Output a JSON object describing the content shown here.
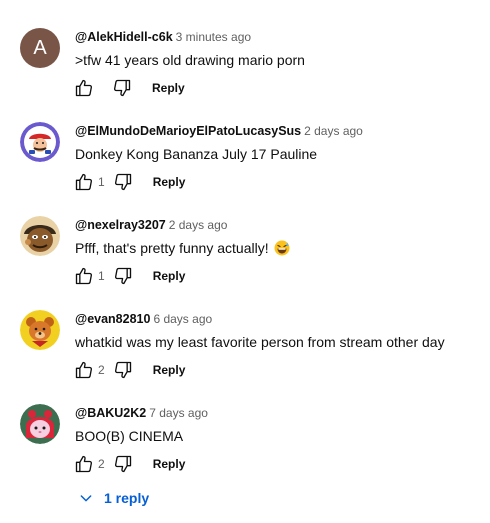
{
  "actions": {
    "reply_label": "Reply"
  },
  "comments": [
    {
      "author": "@AlekHidell-c6k",
      "time": "3 minutes ago",
      "text": ">tfw 41 years old drawing mario porn",
      "likes": "",
      "avatar": {
        "type": "letter",
        "letter": "A",
        "color": "#795548"
      }
    },
    {
      "author": "@ElMundoDeMarioyElPatoLucasySus",
      "time": "2 days ago",
      "text": "Donkey Kong Bananza July 17 Pauline",
      "likes": "1",
      "avatar": {
        "type": "image",
        "icon": "mario-avatar-icon",
        "color": "#6a5acd"
      }
    },
    {
      "author": "@nexelray3207",
      "time": "2 days ago",
      "text": "Pfff, that's pretty funny actually!",
      "emoji": "grinning-sweat-emoji",
      "likes": "1",
      "avatar": {
        "type": "image",
        "icon": "cartoon-face-avatar-icon",
        "color": "#8b5a2b"
      }
    },
    {
      "author": "@evan82810",
      "time": "6 days ago",
      "text": "whatkid was my least favorite person from stream other day",
      "likes": "2",
      "avatar": {
        "type": "image",
        "icon": "bear-avatar-icon",
        "color": "#f2d021"
      }
    },
    {
      "author": "@BAKU2K2",
      "time": "7 days ago",
      "text": "BOO(B) CINEMA",
      "likes": "2",
      "avatar": {
        "type": "image",
        "icon": "pink-hood-avatar-icon",
        "color": "#3c6e4f"
      }
    }
  ],
  "more_replies": {
    "label": "1 reply",
    "color": "#065fd4"
  }
}
